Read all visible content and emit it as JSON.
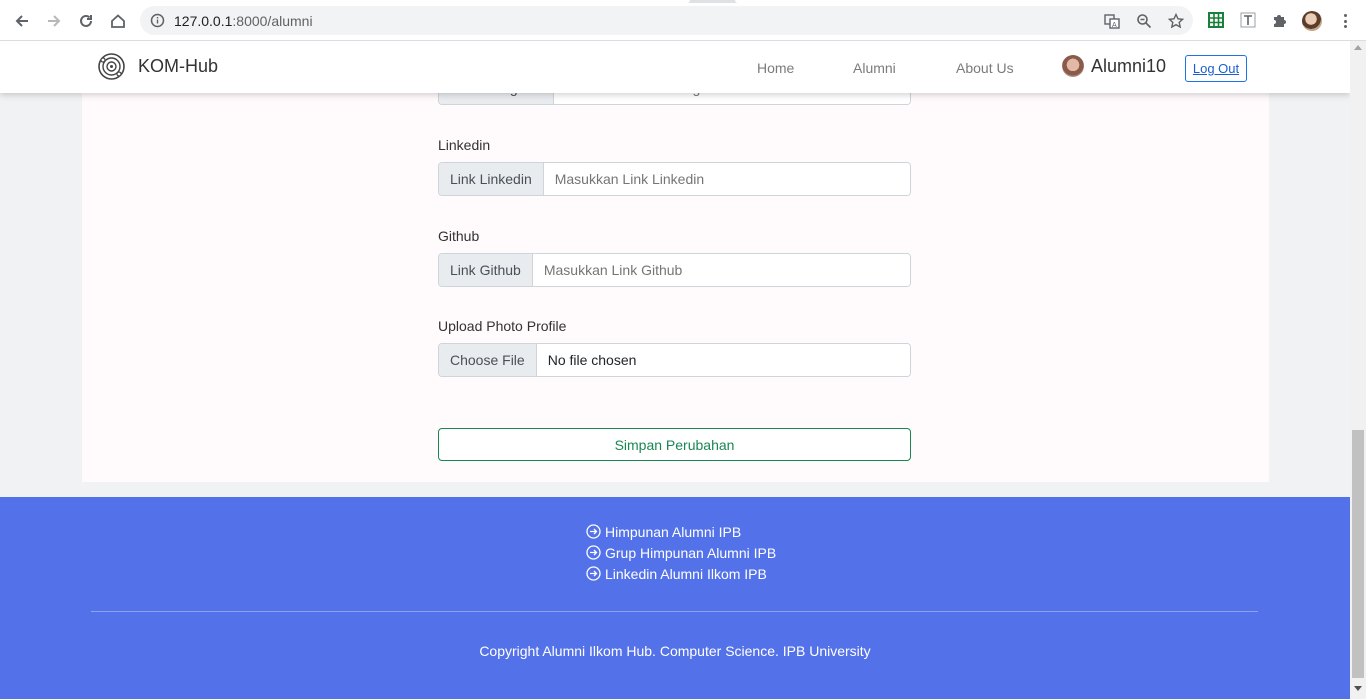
{
  "browser": {
    "url_host": "127.0.0.1",
    "url_path": ":8000/alumni"
  },
  "navbar": {
    "brand": "KOM-Hub",
    "links": [
      "Home",
      "Alumni",
      "About Us"
    ],
    "username": "Alumni10",
    "logout_label": "Log Out"
  },
  "form": {
    "instagram": {
      "addon": "Link Instagram",
      "placeholder": "Masukkan Link Instagram"
    },
    "linkedin": {
      "label": "Linkedin",
      "addon": "Link Linkedin",
      "placeholder": "Masukkan Link Linkedin"
    },
    "github": {
      "label": "Github",
      "addon": "Link Github",
      "placeholder": "Masukkan Link Github"
    },
    "photo": {
      "label": "Upload Photo Profile",
      "button": "Choose File",
      "status": "No file chosen"
    },
    "save_label": "Simpan Perubahan"
  },
  "footer": {
    "links": [
      "Himpunan Alumni IPB",
      "Grup Himpunan Alumni IPB",
      "Linkedin Alumni Ilkom IPB"
    ],
    "copyright": "Copyright Alumni Ilkom Hub. Computer Science. IPB University"
  },
  "colors": {
    "footer_bg": "#5371e8",
    "save_green": "#198754",
    "container_bg": "#fffafb"
  }
}
